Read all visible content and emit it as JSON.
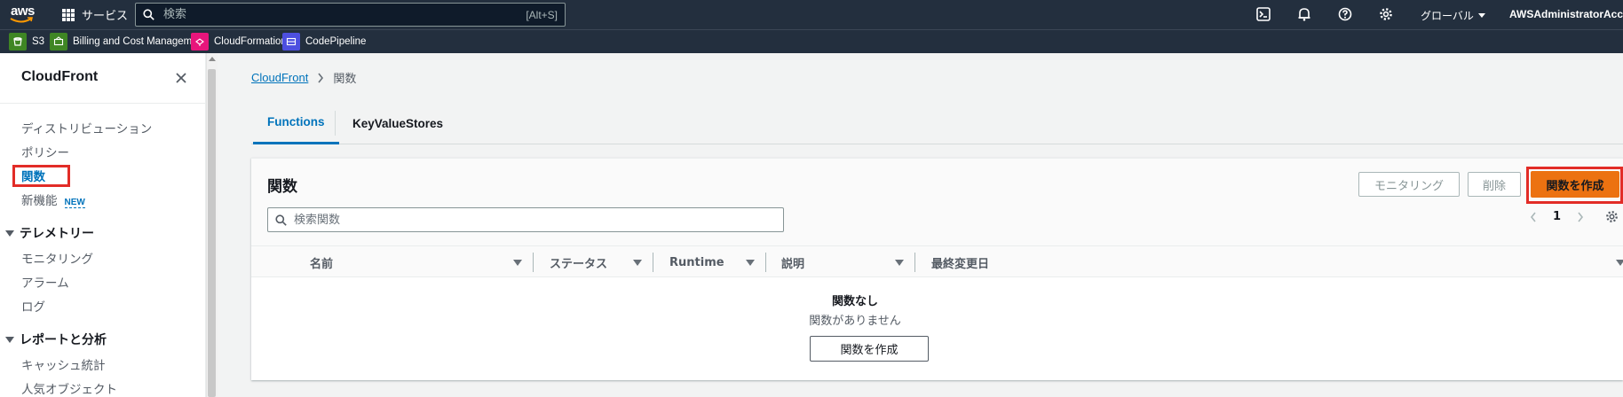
{
  "topnav": {
    "logo": "aws",
    "services_label": "サービス",
    "search_placeholder": "検索",
    "search_shortcut": "[Alt+S]",
    "region_label": "グローバル",
    "account_label": "AWSAdministratorAccess/"
  },
  "favorites": [
    {
      "label": "S3",
      "color": "#3f8624"
    },
    {
      "label": "Billing and Cost Management",
      "color": "#3f8624"
    },
    {
      "label": "CloudFormation",
      "color": "#e7157b"
    },
    {
      "label": "CodePipeline",
      "color": "#4d4fe0"
    }
  ],
  "sidebar": {
    "title": "CloudFront",
    "items": [
      {
        "label": "ディストリビューション"
      },
      {
        "label": "ポリシー"
      },
      {
        "label": "関数",
        "active": true
      },
      {
        "label": "新機能",
        "badge": "NEW"
      }
    ],
    "sections": [
      {
        "title": "テレメトリー",
        "items": [
          "モニタリング",
          "アラーム",
          "ログ"
        ]
      },
      {
        "title": "レポートと分析",
        "items": [
          "キャッシュ統計",
          "人気オブジェクト"
        ]
      }
    ]
  },
  "breadcrumb": {
    "root": "CloudFront",
    "current": "関数"
  },
  "tabs": [
    {
      "label": "Functions",
      "active": true
    },
    {
      "label": "KeyValueStores",
      "active": false
    }
  ],
  "panel": {
    "title": "関数",
    "btn_monitor": "モニタリング",
    "btn_delete": "削除",
    "btn_create": "関数を作成",
    "search_placeholder": "検索関数",
    "page_number": "1",
    "columns": [
      "名前",
      "ステータス",
      "Runtime",
      "説明",
      "最終変更日"
    ],
    "empty_title": "関数なし",
    "empty_desc": "関数がありません",
    "empty_button": "関数を作成"
  },
  "colors": {
    "nav_bg": "#232f3e",
    "accent": "#ec7211",
    "link": "#0073bb",
    "highlight": "#e22c27"
  }
}
